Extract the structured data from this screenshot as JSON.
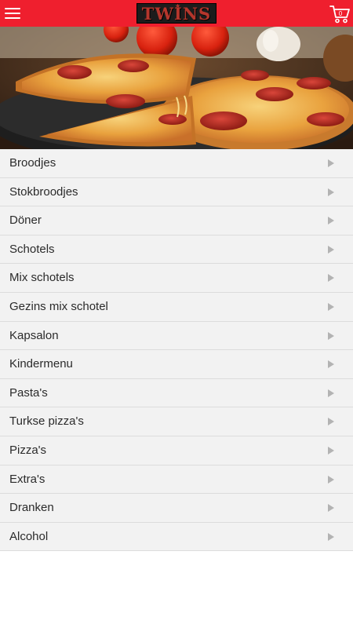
{
  "header": {
    "brand": "TWINS",
    "menu_icon": "hamburger-menu-icon",
    "cart_icon": "shopping-cart-icon",
    "cart_count": "0",
    "background_color": "#ef1f2e"
  },
  "banner": {
    "image": "pizza-photo"
  },
  "menu": {
    "items": [
      {
        "label": "Broodjes"
      },
      {
        "label": "Stokbroodjes"
      },
      {
        "label": "Döner"
      },
      {
        "label": "Schotels"
      },
      {
        "label": "Mix schotels"
      },
      {
        "label": "Gezins mix schotel"
      },
      {
        "label": "Kapsalon"
      },
      {
        "label": "Kindermenu"
      },
      {
        "label": "Pasta's"
      },
      {
        "label": "Turkse pizza's"
      },
      {
        "label": "Pizza's"
      },
      {
        "label": "Extra's"
      },
      {
        "label": "Dranken"
      },
      {
        "label": "Alcohol"
      }
    ],
    "chevron_icon": "chevron-right-icon"
  }
}
